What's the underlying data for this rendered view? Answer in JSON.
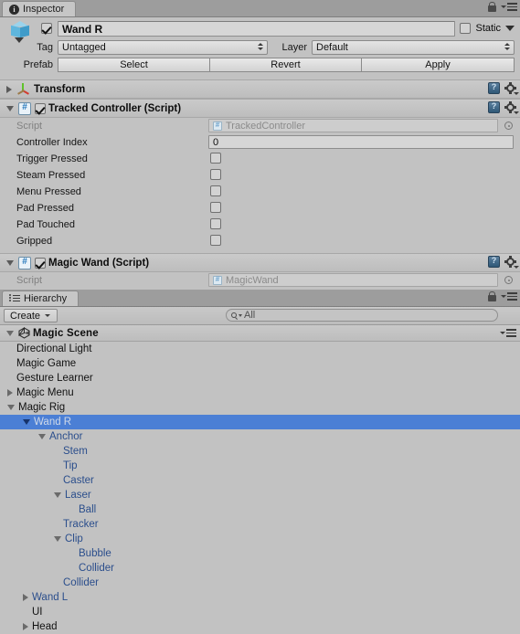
{
  "inspector": {
    "tab_label": "Inspector",
    "tab_icon": "info-icon",
    "lock_icon": "lock-icon",
    "menu_icon": "panel-menu-icon",
    "gameobject": {
      "icon": "prefab-cube-icon",
      "enabled": true,
      "name": "Wand R",
      "static_label": "Static",
      "static_checked": false,
      "static_dropdown_icon": "chevron-down-icon"
    },
    "tag_row": {
      "tag_label": "Tag",
      "tag_value": "Untagged",
      "layer_label": "Layer",
      "layer_value": "Default"
    },
    "prefab_row": {
      "prefab_label": "Prefab",
      "select_label": "Select",
      "revert_label": "Revert",
      "apply_label": "Apply"
    },
    "components": [
      {
        "name": "Transform",
        "icon": "transform-gizmo-icon",
        "expanded": false,
        "has_toggle": false,
        "help_icon": "help-icon",
        "gear_icon": "gear-icon",
        "properties": []
      },
      {
        "name": "Tracked Controller (Script)",
        "icon": "csharp-script-icon",
        "expanded": true,
        "has_toggle": true,
        "enabled": true,
        "help_icon": "help-icon",
        "gear_icon": "gear-icon",
        "properties": [
          {
            "label": "Script",
            "type": "object",
            "value": "TrackedController",
            "dim": true,
            "picker_icon": "object-picker-icon"
          },
          {
            "label": "Controller Index",
            "type": "number",
            "value": "0"
          },
          {
            "label": "Trigger Pressed",
            "type": "bool",
            "value": false
          },
          {
            "label": "Steam Pressed",
            "type": "bool",
            "value": false
          },
          {
            "label": "Menu Pressed",
            "type": "bool",
            "value": false
          },
          {
            "label": "Pad Pressed",
            "type": "bool",
            "value": false
          },
          {
            "label": "Pad Touched",
            "type": "bool",
            "value": false
          },
          {
            "label": "Gripped",
            "type": "bool",
            "value": false
          }
        ]
      },
      {
        "name": "Magic Wand (Script)",
        "icon": "csharp-script-icon",
        "expanded": true,
        "has_toggle": true,
        "enabled": true,
        "help_icon": "help-icon",
        "gear_icon": "gear-icon",
        "properties": [
          {
            "label": "Script",
            "type": "object",
            "value": "MagicWand",
            "dim": true,
            "picker_icon": "object-picker-icon"
          }
        ]
      }
    ]
  },
  "hierarchy": {
    "tab_label": "Hierarchy",
    "tab_icon": "hierarchy-list-icon",
    "lock_icon": "lock-icon",
    "menu_icon": "panel-menu-icon",
    "create_label": "Create",
    "create_dropdown_icon": "chevron-down-icon",
    "search_placeholder": "All",
    "search_icon": "search-icon",
    "search_dropdown_icon": "chevron-down-icon",
    "scene": {
      "name": "Magic Scene",
      "icon": "unity-scene-icon",
      "expanded": true,
      "context_menu_icon": "panel-menu-icon"
    },
    "items": [
      {
        "label": "Directional Light",
        "depth": 1,
        "arrow": "none",
        "prefab": false,
        "selected": false
      },
      {
        "label": "Magic Game",
        "depth": 1,
        "arrow": "none",
        "prefab": false,
        "selected": false
      },
      {
        "label": "Gesture Learner",
        "depth": 1,
        "arrow": "none",
        "prefab": false,
        "selected": false
      },
      {
        "label": "Magic Menu",
        "depth": 1,
        "arrow": "closed",
        "prefab": false,
        "selected": false
      },
      {
        "label": "Magic Rig",
        "depth": 1,
        "arrow": "open",
        "prefab": false,
        "selected": false
      },
      {
        "label": "Wand R",
        "depth": 2,
        "arrow": "open",
        "prefab": true,
        "selected": true
      },
      {
        "label": "Anchor",
        "depth": 3,
        "arrow": "open",
        "prefab": true,
        "selected": false
      },
      {
        "label": "Stem",
        "depth": 4,
        "arrow": "none",
        "prefab": true,
        "selected": false
      },
      {
        "label": "Tip",
        "depth": 4,
        "arrow": "none",
        "prefab": true,
        "selected": false
      },
      {
        "label": "Caster",
        "depth": 4,
        "arrow": "none",
        "prefab": true,
        "selected": false
      },
      {
        "label": "Laser",
        "depth": 4,
        "arrow": "open",
        "prefab": true,
        "selected": false
      },
      {
        "label": "Ball",
        "depth": 5,
        "arrow": "none",
        "prefab": true,
        "selected": false
      },
      {
        "label": "Tracker",
        "depth": 4,
        "arrow": "none",
        "prefab": true,
        "selected": false
      },
      {
        "label": "Clip",
        "depth": 4,
        "arrow": "open",
        "prefab": true,
        "selected": false
      },
      {
        "label": "Bubble",
        "depth": 5,
        "arrow": "none",
        "prefab": true,
        "selected": false
      },
      {
        "label": "Collider",
        "depth": 5,
        "arrow": "none",
        "prefab": true,
        "selected": false
      },
      {
        "label": "Collider",
        "depth": 4,
        "arrow": "none",
        "prefab": true,
        "selected": false
      },
      {
        "label": "Wand L",
        "depth": 2,
        "arrow": "closed",
        "prefab": true,
        "selected": false
      },
      {
        "label": "UI",
        "depth": 2,
        "arrow": "none",
        "prefab": false,
        "selected": false
      },
      {
        "label": "Head",
        "depth": 2,
        "arrow": "closed",
        "prefab": false,
        "selected": false
      }
    ]
  },
  "colors": {
    "panel_bg": "#c2c2c2",
    "selection_blue": "#4b7fd5",
    "prefab_text": "#2b4e8c",
    "tabstrip": "#9d9d9d"
  }
}
